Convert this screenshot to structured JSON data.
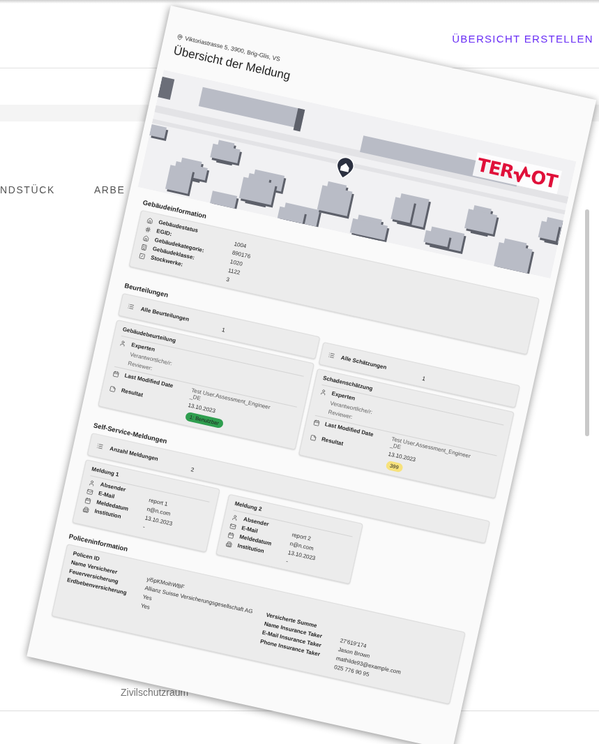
{
  "header": {
    "action_button": "ÜBERSICHT ERSTELLEN"
  },
  "tabs": [
    {
      "label": "NDSTÜCK"
    },
    {
      "label": "ARBE"
    }
  ],
  "background_field": "Zivilschutzraum",
  "report": {
    "address": "Viktoriastrasse 5, 3900, Brig-Glis, VS",
    "title": "Übersicht der Meldung",
    "logo": {
      "left": "TER",
      "right": "OT"
    },
    "building_info": {
      "heading": "Gebäudeinformation",
      "labels": [
        "Gebäudestatus",
        "EGID:",
        "Gebäudekategorie:",
        "Gebäudeklasse:",
        "Stockwerke:"
      ],
      "values": [
        "1004",
        "890176",
        "1020",
        "1122",
        "3"
      ]
    },
    "assessments_heading": "Beurteilungen",
    "assessment_columns": [
      {
        "summary_label": "Alle Beurteilungen",
        "summary_value": "1",
        "card": {
          "title": "Gebäudebeurteilung",
          "experts": "Experten",
          "responsible": "Verantwortliche/r:",
          "reviewer": "Reviewer:",
          "date_label": "Last Modified Date",
          "result_label": "Resultat",
          "author": "Test User.Assessment_Engineer_DE",
          "date": "13.10.2023",
          "badge": {
            "text": "1: Benutzbar",
            "color": "#2f9e4f"
          }
        }
      },
      {
        "summary_label": "Alle Schätzungen",
        "summary_value": "1",
        "card": {
          "title": "Schadenschätzung",
          "experts": "Experten",
          "responsible": "Verantwortliche/r:",
          "reviewer": "Reviewer:",
          "date_label": "Last Modified Date",
          "result_label": "Resultat",
          "author": "Test User.Assessment_Engineer_DE",
          "date": "13.10.2023",
          "badge": {
            "text": "399",
            "color": "#f7e27c"
          }
        }
      }
    ],
    "self_service": {
      "heading": "Self-Service-Meldungen",
      "summary_label": "Anzahl Meldungen",
      "summary_value": "2",
      "reports": [
        {
          "title": "Meldung 1",
          "labels": [
            "Absender",
            "E-Mail",
            "Meldedatum",
            "Institution"
          ],
          "values": [
            "report 1",
            "n@n.com",
            "13.10.2023",
            "-"
          ]
        },
        {
          "title": "Meldung 2",
          "labels": [
            "Absender",
            "E-Mail",
            "Meldedatum",
            "Institution"
          ],
          "values": [
            "report 2",
            "n@n.com",
            "13.10.2023",
            "-"
          ]
        }
      ]
    },
    "policy": {
      "heading": "Policeninformation",
      "left": {
        "labels": [
          "Policen ID",
          "Name Versicherer",
          "Feuerversicherung",
          "Erdbebenversicherung"
        ],
        "values": [
          "yi5pKMoihWBF",
          "Allianz Suisse Versicherungsgesellschaft AG",
          "Yes",
          "Yes"
        ]
      },
      "right": {
        "labels": [
          "Versicherte Summe",
          "Name Insurance Taker",
          "E-Mail Insurance Taker",
          "Phone Insurance Taker"
        ],
        "values": [
          "27'619'174",
          "Jason Brown",
          "mathilde93@example.com",
          "025 776 90 95"
        ]
      }
    }
  }
}
